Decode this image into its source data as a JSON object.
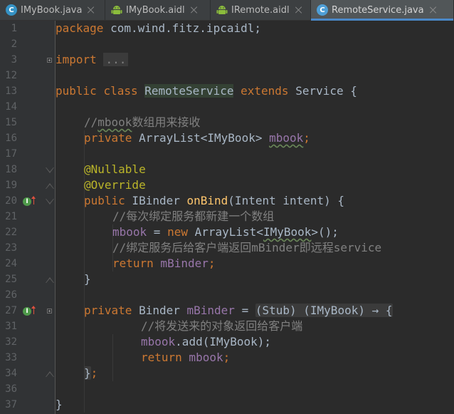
{
  "tabs": [
    {
      "label": "IMyBook.java",
      "icon": "java-class-icon",
      "active": false
    },
    {
      "label": "IMyBook.aidl",
      "icon": "android-icon",
      "active": false
    },
    {
      "label": "IRemote.aidl",
      "icon": "android-icon",
      "active": false
    },
    {
      "label": "RemoteService.java",
      "icon": "java-class-icon",
      "active": true
    }
  ],
  "editor": {
    "line_numbers": [
      "1",
      "2",
      "3",
      "12",
      "13",
      "14",
      "15",
      "16",
      "17",
      "18",
      "19",
      "20",
      "21",
      "22",
      "23",
      "24",
      "25",
      "26",
      "27",
      "31",
      "32",
      "33",
      "34",
      "36",
      "37"
    ],
    "code": {
      "l1": {
        "kw": "package",
        "text": " com.wind.fitz.ipcaidl;"
      },
      "l3": {
        "kw": "import",
        "dots": "..."
      },
      "l13": {
        "kw1": "public",
        "kw2": "class",
        "cls": "RemoteService",
        "kw3": "extends",
        "rest": " Service {"
      },
      "l15": {
        "c1": "//",
        "c2": "mbook",
        "c3": "数组用来接收"
      },
      "l16": {
        "kw": "private",
        "type": " ArrayList<IMyBook> ",
        "field": "mbook",
        "end": ";"
      },
      "l18": {
        "ann": "@Nullable"
      },
      "l19": {
        "ann": "@Override"
      },
      "l20": {
        "kw": "public",
        "t1": " IBinder ",
        "fn": "onBind",
        "t2": "(Intent intent) {"
      },
      "l21": {
        "cm": "//每次绑定服务都新建一个数组"
      },
      "l22": {
        "field": "mbook",
        "t1": " = ",
        "kw": "new",
        "t2": " ArrayList<",
        "t3": "IMyBook",
        "t4": ">();"
      },
      "l23": {
        "cm": "//绑定服务后给客户端返回mBinder即远程service"
      },
      "l24": {
        "kw": "return",
        "field": " mBinder",
        "end": ";"
      },
      "l25": {
        "text": "}"
      },
      "l27": {
        "kw": "private",
        "t1": " Binder ",
        "field": "mBinder",
        "t2": " = ",
        "fold": "(Stub) (IMyBook) → {"
      },
      "l31": {
        "cm": "//将发送来的对象返回给客户端"
      },
      "l32": {
        "field": "mbook",
        "t1": ".add(IMyBook);"
      },
      "l33": {
        "kw": "return",
        "field": " mbook",
        "end": ";"
      },
      "l34": {
        "t1": "}",
        "end": ";"
      },
      "l37": {
        "text": "}"
      }
    }
  },
  "colors": {
    "background": "#2b2b2b",
    "gutter": "#313335",
    "keyword": "#cc7832",
    "annotation": "#bbb529",
    "field": "#9876aa",
    "function": "#ffc66d",
    "comment": "#808080",
    "text": "#a9b7c6",
    "active_tab_underline": "#4a88c7"
  }
}
